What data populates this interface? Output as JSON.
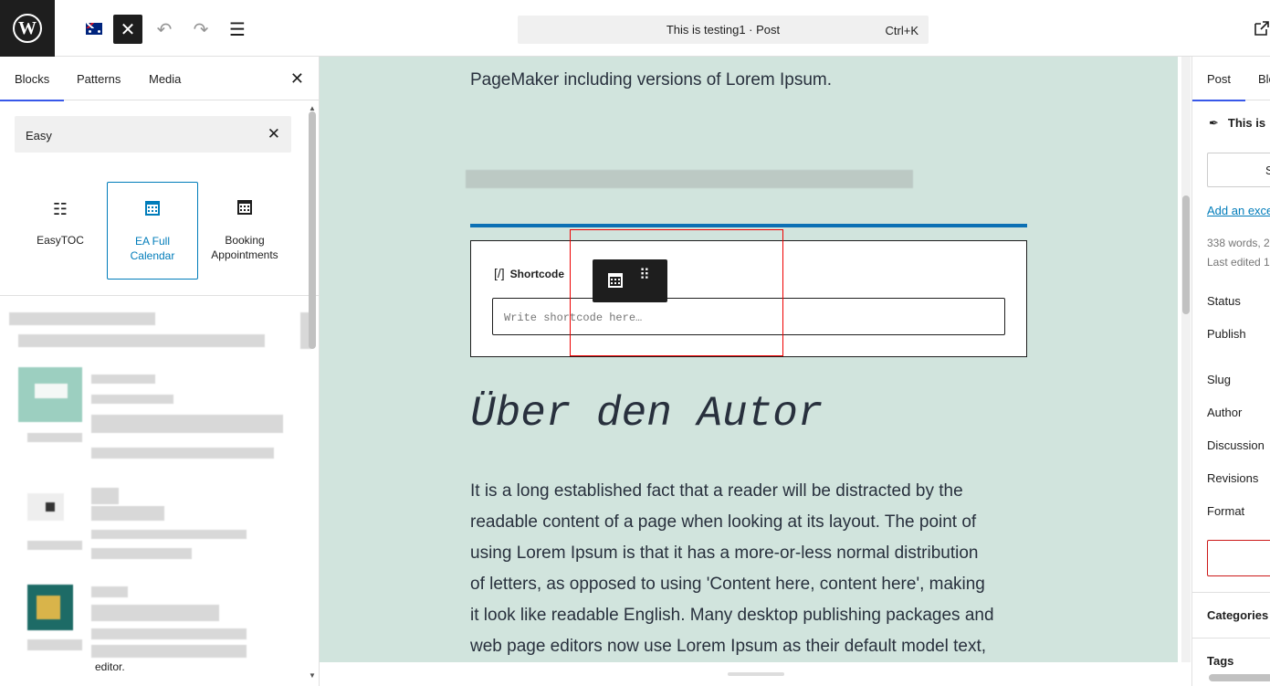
{
  "topbar": {
    "post_title": "This is testing1 · Post",
    "shortcut": "Ctrl+K",
    "icons": [
      "wordpress-logo",
      "flag-australia",
      "close-icon",
      "undo-icon",
      "redo-icon",
      "list-view-icon",
      "external-link-icon"
    ]
  },
  "inserter": {
    "tabs": [
      "Blocks",
      "Patterns",
      "Media"
    ],
    "search_value": "Easy",
    "results": [
      {
        "label": "EasyTOC",
        "icon": "list-icon"
      },
      {
        "label": "EA Full Calendar",
        "icon": "calendar-icon"
      },
      {
        "label": "Booking Appointments",
        "icon": "calendar-icon"
      }
    ],
    "snippet": "editor."
  },
  "canvas": {
    "top_text": "PageMaker including versions of Lorem Ipsum.",
    "shortcode_label": "Shortcode",
    "shortcode_icon": "[/]",
    "shortcode_placeholder": "Write shortcode here…",
    "heading": "Über den Autor",
    "paragraph_lines": [
      "It is a long established fact that a reader will be distracted by the",
      "readable content of a page when looking at its layout. The point of",
      "using Lorem Ipsum is that it has a more-or-less normal distribution",
      "of letters, as opposed to using 'Content here, content here', making",
      "it look like readable English. Many desktop publishing packages and",
      "web page editors now use Lorem Ipsum as their default model text,"
    ],
    "colors": {
      "background": "#d1e4dd",
      "separator": "#0c70b4",
      "highlight": "#ee0000"
    }
  },
  "sidebar": {
    "tabs": [
      "Post",
      "Blo"
    ],
    "title": "This is",
    "button": "S",
    "excerpt_link": "Add an exce",
    "meta1": "338 words, 2",
    "meta2": "Last edited 1",
    "rows": [
      "Status",
      "Publish",
      "Slug",
      "Author",
      "Discussion",
      "Revisions",
      "Format"
    ],
    "categories": "Categories",
    "tags": "Tags"
  }
}
